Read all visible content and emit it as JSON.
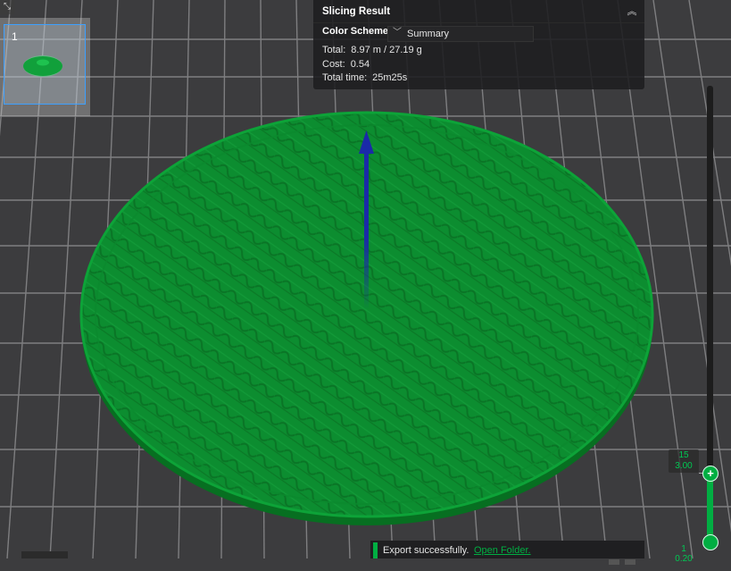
{
  "plate": {
    "number": "1"
  },
  "result_panel": {
    "title": "Slicing Result",
    "color_scheme_label": "Color Scheme",
    "color_scheme_value": "Summary",
    "total_label": "Total:",
    "total_value": "8.97 m / 27.19 g",
    "cost_label": "Cost:",
    "cost_value": "0.54",
    "time_label": "Total time:",
    "time_value": "25m25s"
  },
  "layer_slider": {
    "top_layer": "15",
    "top_height": "3.00",
    "bottom_layer": "1",
    "bottom_height": "0.20"
  },
  "notification": {
    "message": "Export successfully.",
    "link": "Open Folder."
  },
  "colors": {
    "accent": "#00ae42",
    "model": "#0a8a2e",
    "axis": "#1530a0",
    "selection": "#3da0ff"
  },
  "icons": {
    "collapse": "chevron-up-double-icon",
    "dropdown": "chevron-down-icon",
    "expand_corner": "expand-arrows-icon",
    "slider_handle": "plus-icon"
  }
}
